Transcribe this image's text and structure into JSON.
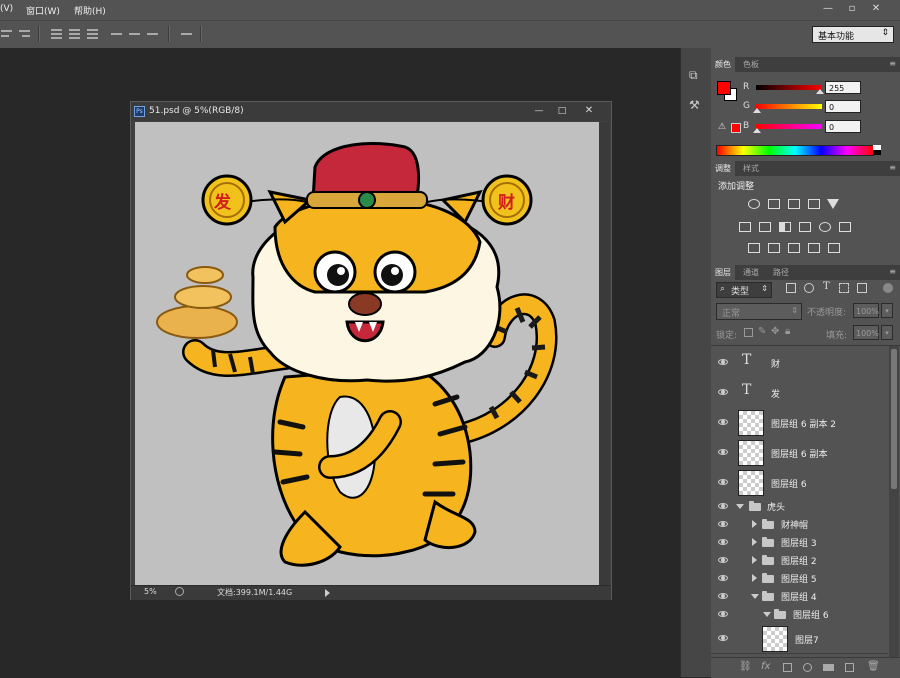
{
  "menu": {
    "view_fragment": "(V)",
    "window": "窗口(W)",
    "help": "帮助(H)"
  },
  "workspace_preset": "基本功能",
  "document": {
    "title": "51.psd @ 5%(RGB/8)",
    "zoom": "5%",
    "doc_size": "文档:399.1M/1.44G"
  },
  "artwork": {
    "left_coin": "发",
    "right_coin": "财"
  },
  "color_panel": {
    "tabs": [
      "颜色",
      "色板"
    ],
    "channels": [
      {
        "label": "R",
        "value": "255"
      },
      {
        "label": "G",
        "value": "0"
      },
      {
        "label": "B",
        "value": "0"
      }
    ],
    "foreground": "#ff0000",
    "background": "#ffffff"
  },
  "adjust_panel": {
    "tabs": [
      "调整",
      "样式"
    ],
    "heading": "添加调整"
  },
  "layers_panel": {
    "tabs": [
      "图层",
      "通道",
      "路径"
    ],
    "filter_kind": "类型",
    "blend_mode": "正常",
    "opacity_label": "不透明度:",
    "opacity_value": "100%",
    "lock_label": "锁定:",
    "fill_label": "填充:",
    "fill_value": "100%",
    "layers": [
      {
        "name": "财",
        "type": "text"
      },
      {
        "name": "发",
        "type": "text"
      },
      {
        "name": "图层组 6 副本 2",
        "type": "pixel"
      },
      {
        "name": "图层组 6 副本",
        "type": "pixel"
      },
      {
        "name": "图层组 6",
        "type": "pixel"
      },
      {
        "name": "虎头",
        "type": "group-open"
      },
      {
        "name": "财神帽",
        "type": "group"
      },
      {
        "name": "图层组 3",
        "type": "group"
      },
      {
        "name": "图层组 2",
        "type": "group"
      },
      {
        "name": "图层组 5",
        "type": "group"
      },
      {
        "name": "图层组 4",
        "type": "group-open"
      },
      {
        "name": "图层组 6",
        "type": "group-open"
      },
      {
        "name": "图层7",
        "type": "pixel"
      }
    ]
  }
}
